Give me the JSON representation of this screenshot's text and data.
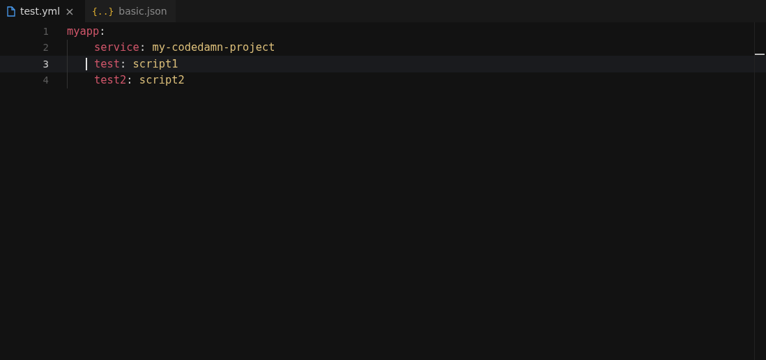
{
  "tabs": [
    {
      "label": "test.yml",
      "kind": "file",
      "selected": true,
      "close": "×"
    },
    {
      "label": "basic.json",
      "kind": "json",
      "icon": "{..}",
      "selected": false
    }
  ],
  "lines": [
    {
      "number": "1",
      "key": "myapp",
      "colon": ":",
      "selected": false,
      "children": [
        {
          "number": "2",
          "key": "service",
          "colon": ":",
          "value": "my-codedamn-project",
          "selected": false
        },
        {
          "number": "3",
          "key": "test",
          "colon": ":",
          "value": "script1",
          "selected": true
        },
        {
          "number": "4",
          "key": "test2",
          "colon": ":",
          "value": "script2",
          "selected": false
        }
      ]
    }
  ]
}
